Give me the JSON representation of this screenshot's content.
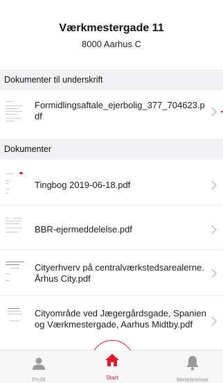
{
  "header": {
    "title": "Værkmestergade 11",
    "subtitle": "8000 Aarhus C"
  },
  "sections": {
    "to_sign": {
      "title": "Dokumenter til underskrift",
      "items": [
        {
          "label": "Formidlingsaftale_ejerbolig_377_704623.pdf"
        }
      ]
    },
    "documents": {
      "title": "Dokumenter",
      "items": [
        {
          "label": "Tingbog 2019-06-18.pdf"
        },
        {
          "label": "BBR-ejermeddelelse.pdf"
        },
        {
          "label": "Cityerhverv på centralværkstedsarealerne. Århus City.pdf"
        },
        {
          "label": "Cityområde ved Jægergårdsgade, Spanien og Værkmestergade, Aarhus Midtby.pdf"
        }
      ]
    }
  },
  "tabbar": {
    "profile_label": "Profil",
    "start_label": "Start",
    "messages_label": "Meddelelser"
  },
  "icons": {
    "profile": "person-icon",
    "start": "home-icon",
    "messages": "bell-icon",
    "chevron": "chevron-right-icon",
    "document": "document-thumbnail-icon"
  },
  "colors": {
    "accent": "#e21a2c",
    "section_bg": "#f2f2f4",
    "tab_inactive": "#9a9a9a"
  }
}
